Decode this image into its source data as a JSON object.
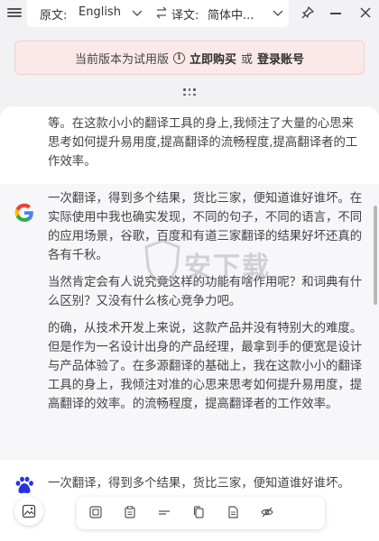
{
  "topbar": {
    "source_label": "原文:",
    "source_value": "English",
    "target_label": "译文:",
    "target_value": "简体中..."
  },
  "trial": {
    "message": "当前版本为试用版",
    "buy_label": "立即购买",
    "or_label": "或",
    "login_label": "登录账号"
  },
  "results": [
    {
      "engine": "",
      "icon": "engine-icon",
      "paragraphs": [
        "等。在这款小小的翻译工具的身上,我倾注了大量的心思来思考如何提升易用度,提高翻译的流畅程度,提高翻译者的工作效率。"
      ]
    },
    {
      "engine": "Google",
      "icon": "google-icon",
      "paragraphs": [
        "一次翻译，得到多个结果，货比三家，便知道谁好谁坏。在实际使用中我也确实发现，不同的句子，不同的语言，不同的应用场景，谷歌，百度和有道三家翻译的结果好坏还真的各有千秋。",
        "当然肯定会有人说究竟这样的功能有啥作用呢？和词典有什么区别？又没有什么核心竞争力吧。",
        "的确，从技术开发上来说，这款产品并没有特别大的难度。但是作为一名设计出身的产品经理，最拿到手的便宽是设计与产品体验了。在多源翻译的基础上，我在这款小小的翻译工具的身上，我倾注对准的心思来思考如何提升易用度，提高翻译的效率。的流畅程度，提高翻译者的工作效率。"
      ]
    },
    {
      "engine": "Baidu",
      "icon": "baidu-icon",
      "paragraphs": [
        "一次翻译，得到多个结果，货比三家，便知道谁好谁坏。"
      ]
    }
  ],
  "watermark": {
    "text": "安下载",
    "sub": "anxz.com"
  },
  "toolbar": {
    "buttons": [
      "screenshot-translate",
      "copy-source",
      "paste",
      "single-line",
      "copy",
      "copy-result",
      "hide"
    ]
  },
  "colors": {
    "banner_bg": "#fbe9e9",
    "panel_bg": "#ffffff",
    "highlight_card": "#f7f6f9"
  }
}
